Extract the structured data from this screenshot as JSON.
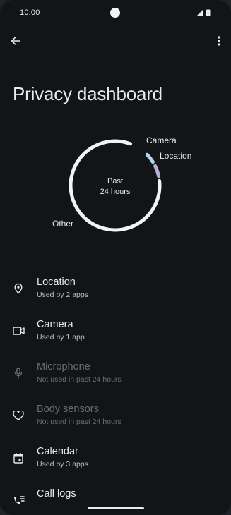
{
  "status_bar": {
    "time": "10:00"
  },
  "app_bar": {
    "back_icon": "arrow-back-icon",
    "menu_icon": "more-vert-icon"
  },
  "page": {
    "title": "Privacy dashboard"
  },
  "usage_chart": {
    "center_line1": "Past",
    "center_line2": "24 hours",
    "labels": {
      "camera": "Camera",
      "location": "Location",
      "other": "Other"
    },
    "colors": {
      "other": "#f1f3f4",
      "camera": "#b3d4f5",
      "location": "#b8aed4"
    }
  },
  "permissions": [
    {
      "name": "Location",
      "status": "Used by 2 apps",
      "icon": "location-pin-icon",
      "enabled": true
    },
    {
      "name": "Camera",
      "status": "Used by 1 app",
      "icon": "videocam-icon",
      "enabled": true
    },
    {
      "name": "Microphone",
      "status": "Not used in past 24 hours",
      "icon": "microphone-icon",
      "enabled": false
    },
    {
      "name": "Body sensors",
      "status": "Not used in past 24 hours",
      "icon": "heart-icon",
      "enabled": false
    },
    {
      "name": "Calendar",
      "status": "Used by 3 apps",
      "icon": "calendar-icon",
      "enabled": true
    },
    {
      "name": "Call logs",
      "status": "",
      "icon": "call-log-icon",
      "enabled": true
    }
  ]
}
